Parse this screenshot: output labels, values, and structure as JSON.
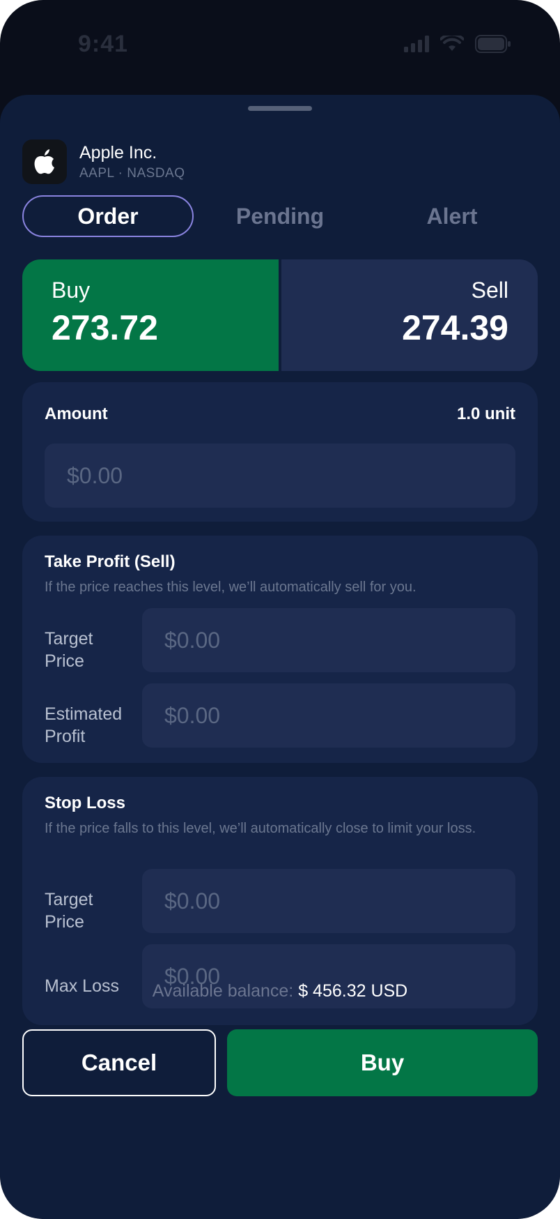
{
  "status": {
    "time": "9:41"
  },
  "instrument": {
    "name": "Apple Inc.",
    "subtitle": "AAPL · NASDAQ",
    "logo_icon": "apple-logo-icon"
  },
  "tabs": [
    {
      "label": "Order",
      "active": true
    },
    {
      "label": "Pending",
      "active": false
    },
    {
      "label": "Alert",
      "active": false
    }
  ],
  "quote": {
    "buy_label": "Buy",
    "buy_price": "273.72",
    "sell_label": "Sell",
    "sell_price": "274.39",
    "buy_color": "#037646",
    "sell_color": "#1f2d52"
  },
  "amount": {
    "title": "Amount",
    "units": "1.0 unit",
    "placeholder": "$0.00"
  },
  "take_profit": {
    "title": "Take Profit (Sell)",
    "description": "If the price reaches this level, we’ll automatically sell for you.",
    "target_label": "Target Price",
    "target_placeholder": "$0.00",
    "estimate_label": "Estimated Profit",
    "estimate_placeholder": "$0.00"
  },
  "stop_loss": {
    "title": "Stop Loss",
    "description": "If the price falls to this level, we’ll automatically close to limit your loss.",
    "target_label": "Target Price",
    "target_placeholder": "$0.00",
    "max_label": "Max Loss",
    "max_placeholder": "$0.00"
  },
  "balance": {
    "label": "Available balance:",
    "value": "$ 456.32 USD"
  },
  "actions": {
    "cancel_label": "Cancel",
    "buy_label": "Buy"
  },
  "colors": {
    "background": "#0a0e1a",
    "sheet": "#0f1d3a",
    "card": "#162548",
    "accent_green": "#037646",
    "tab_outline": "#8a84e0"
  }
}
